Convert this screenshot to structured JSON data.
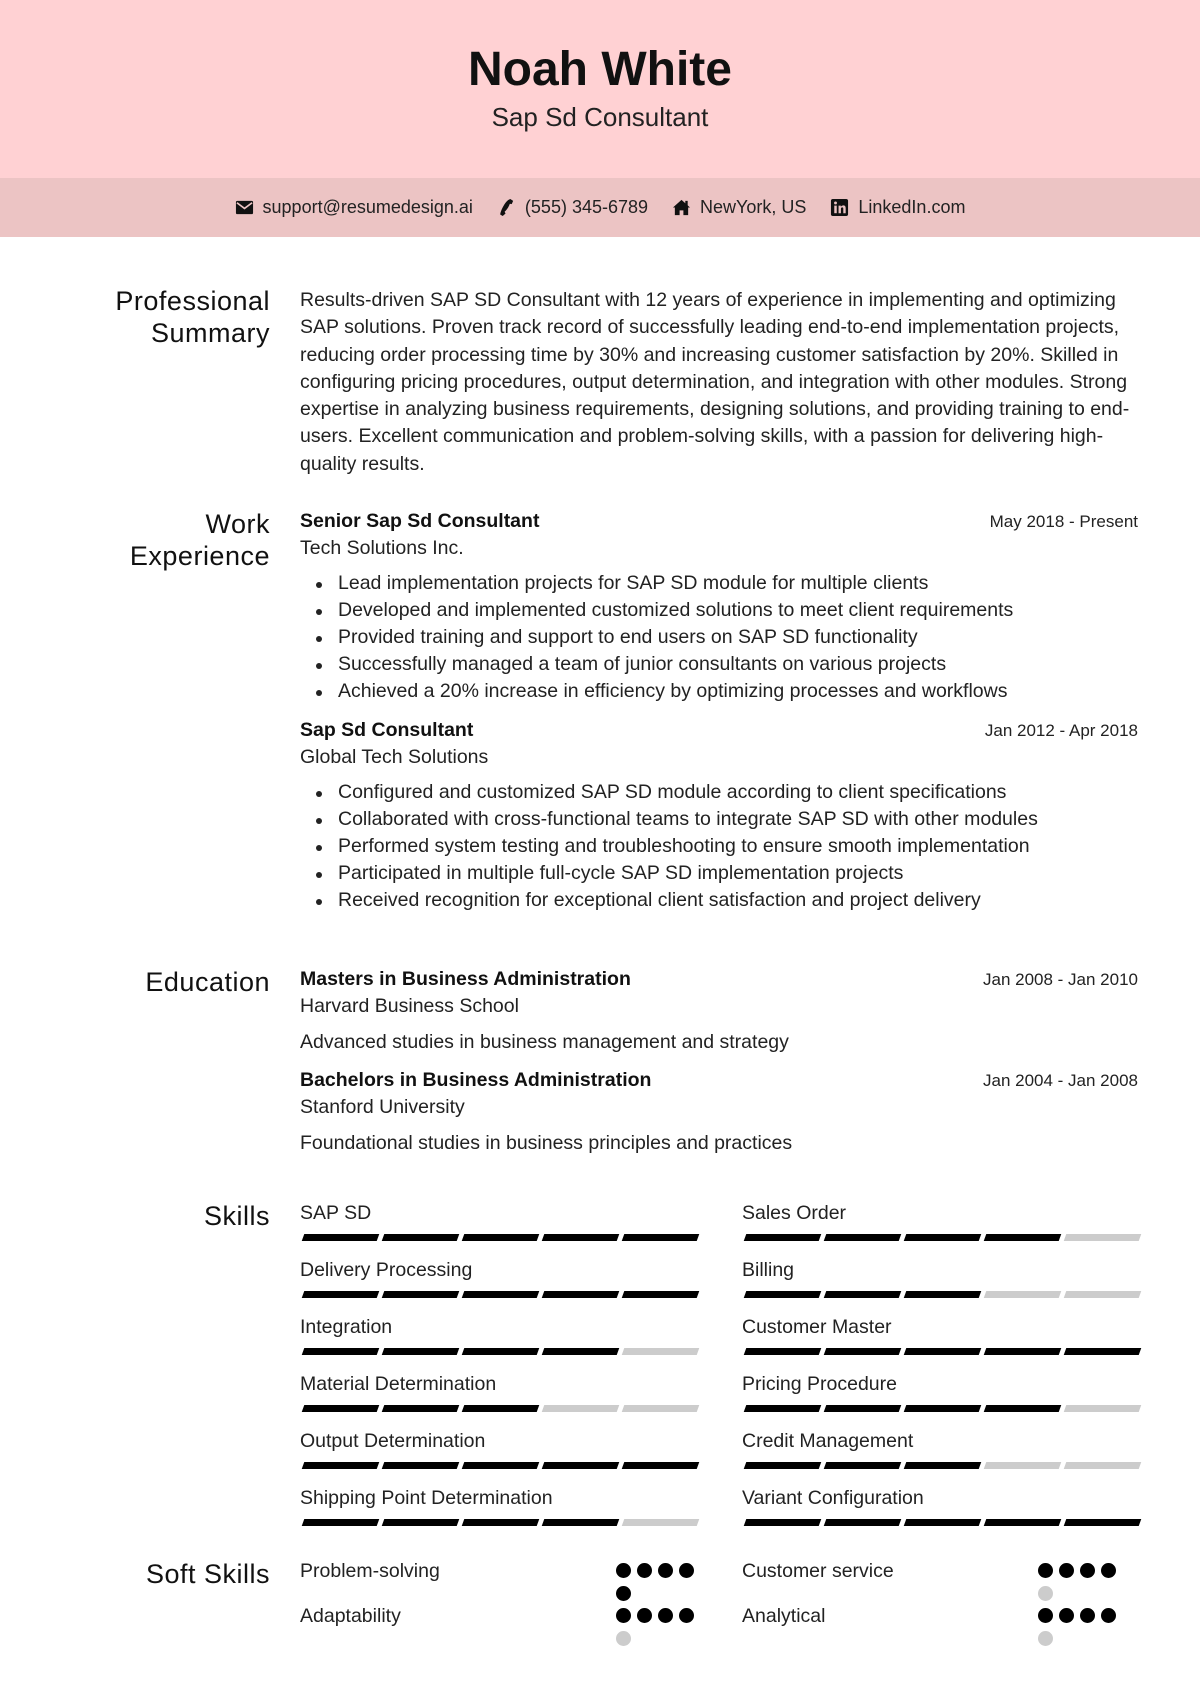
{
  "header": {
    "name": "Noah White",
    "title": "Sap Sd Consultant"
  },
  "contact": [
    {
      "icon": "envelope-icon",
      "text": "support@resumedesign.ai"
    },
    {
      "icon": "phone-icon",
      "text": "(555) 345-6789"
    },
    {
      "icon": "home-icon",
      "text": "NewYork, US"
    },
    {
      "icon": "linkedin-icon",
      "text": "LinkedIn.com"
    }
  ],
  "summary": {
    "heading_line1": "Professional",
    "heading_line2": "Summary",
    "text": "Results-driven SAP SD Consultant with 12 years of experience in implementing and optimizing SAP solutions. Proven track record of successfully leading end-to-end implementation projects, reducing order processing time by 30% and increasing customer satisfaction by 20%. Skilled in configuring pricing procedures, output determination, and integration with other modules. Strong expertise in analyzing business requirements, designing solutions, and providing training to end-users. Excellent communication and problem-solving skills, with a passion for delivering high-quality results."
  },
  "experience": {
    "heading_line1": "Work",
    "heading_line2": "Experience",
    "jobs": [
      {
        "role": "Senior Sap Sd Consultant",
        "date": "May 2018 - Present",
        "org": "Tech Solutions Inc.",
        "bullets": [
          "Lead implementation projects for SAP SD module for multiple clients",
          "Developed and implemented customized solutions to meet client requirements",
          "Provided training and support to end users on SAP SD functionality",
          "Successfully managed a team of junior consultants on various projects",
          "Achieved a 20% increase in efficiency by optimizing processes and workflows"
        ]
      },
      {
        "role": "Sap Sd Consultant",
        "date": "Jan 2012 - Apr 2018",
        "org": "Global Tech Solutions",
        "bullets": [
          "Configured and customized SAP SD module according to client specifications",
          "Collaborated with cross-functional teams to integrate SAP SD with other modules",
          "Performed system testing and troubleshooting to ensure smooth implementation",
          "Participated in multiple full-cycle SAP SD implementation projects",
          "Received recognition for exceptional client satisfaction and project delivery"
        ]
      }
    ]
  },
  "education": {
    "heading": "Education",
    "items": [
      {
        "degree": "Masters in Business Administration",
        "date": "Jan 2008 - Jan 2010",
        "school": "Harvard Business School",
        "desc": "Advanced studies in business management and strategy"
      },
      {
        "degree": "Bachelors in Business Administration",
        "date": "Jan 2004 - Jan 2008",
        "school": "Stanford University",
        "desc": "Foundational studies in business principles and practices"
      }
    ]
  },
  "skills": {
    "heading": "Skills",
    "max": 5,
    "items": [
      {
        "name": "SAP SD",
        "level": 5
      },
      {
        "name": "Sales Order",
        "level": 4
      },
      {
        "name": "Delivery Processing",
        "level": 5
      },
      {
        "name": "Billing",
        "level": 3
      },
      {
        "name": "Integration",
        "level": 4
      },
      {
        "name": "Customer Master",
        "level": 5
      },
      {
        "name": "Material Determination",
        "level": 3
      },
      {
        "name": "Pricing Procedure",
        "level": 4
      },
      {
        "name": "Output Determination",
        "level": 5
      },
      {
        "name": "Credit Management",
        "level": 3
      },
      {
        "name": "Shipping Point Determination",
        "level": 4
      },
      {
        "name": "Variant Configuration",
        "level": 5
      }
    ]
  },
  "soft_skills": {
    "heading": "Soft Skills",
    "max": 5,
    "items": [
      {
        "name": "Problem-solving",
        "level": 5
      },
      {
        "name": "Customer service",
        "level": 4
      },
      {
        "name": "Adaptability",
        "level": 4
      },
      {
        "name": "Analytical",
        "level": 4
      }
    ]
  }
}
